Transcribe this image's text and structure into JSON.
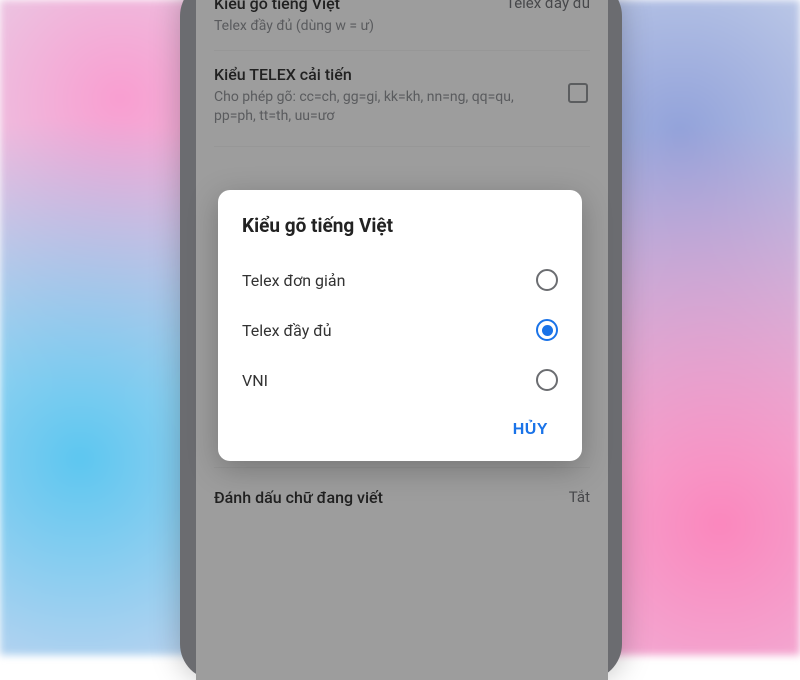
{
  "settings": {
    "row1": {
      "title": "Kiểu gõ tiếng Việt",
      "sub": "Telex đầy đủ (dùng w = ư)",
      "value": "Telex đầy đủ"
    },
    "row2": {
      "title": "Kiểu TELEX cải tiến",
      "sub": "Cho phép gõ: cc=ch, gg=gi, kk=kh, nn=ng, qq=qu, pp=ph, tt=th, uu=ươ"
    },
    "row3": {
      "title": "Đánh dấu chữ đang viết",
      "value": "Tắt"
    }
  },
  "dialog": {
    "title": "Kiểu gõ tiếng Việt",
    "options": [
      {
        "label": "Telex đơn giản",
        "selected": false
      },
      {
        "label": "Telex đầy đủ",
        "selected": true
      },
      {
        "label": "VNI",
        "selected": false
      }
    ],
    "cancel": "HỦY"
  }
}
